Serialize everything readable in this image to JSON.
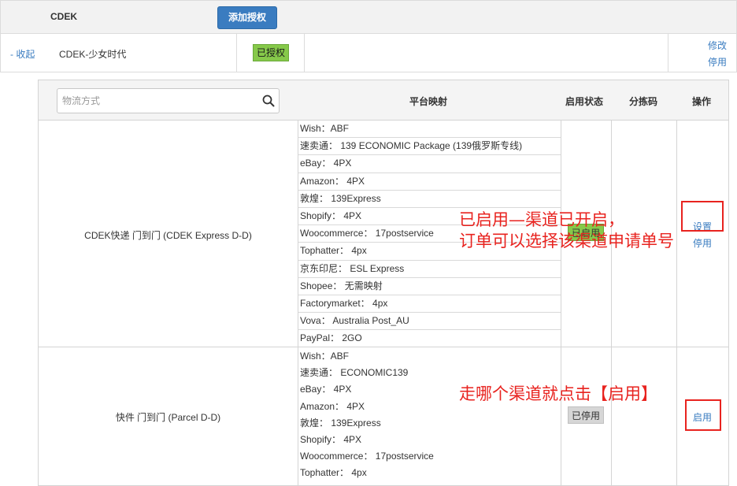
{
  "header": {
    "carrier_name": "CDEK",
    "add_auth_label": "添加授权"
  },
  "account": {
    "collapse_label": "- 收起",
    "name": "CDEK-少女时代",
    "auth_status": "已授权",
    "edit_label": "修改",
    "disable_label": "停用"
  },
  "table": {
    "search_placeholder": "物流方式",
    "columns": {
      "mapping": "平台映射",
      "status": "启用状态",
      "sort_code": "分拣码",
      "actions": "操作"
    },
    "rows": [
      {
        "channel": "CDEK快递 门到门 (CDEK Express D-D)",
        "mappings": [
          "Wish：ABF",
          "速卖通：  139 ECONOMIC Package (139俄罗斯专线)",
          "eBay：  4PX",
          "Amazon：  4PX",
          "敦煌：  139Express",
          "Shopify：  4PX",
          "Woocommerce：  17postservice",
          "Tophatter：  4px",
          "京东印尼：  ESL Express",
          "Shopee：  无需映射",
          "Factorymarket：  4px",
          "Vova：  Australia Post_AU",
          "PayPal：  2GO"
        ],
        "status": "已启用",
        "sort_code": "",
        "action_primary": "设置",
        "action_secondary": "停用"
      },
      {
        "channel": "快件 门到门 (Parcel D-D)",
        "mappings": [
          "Wish：ABF",
          "速卖通：  ECONOMIC139",
          "eBay：  4PX",
          "Amazon：  4PX",
          "敦煌：  139Express",
          "Shopify：  4PX",
          "Woocommerce：  17postservice",
          "Tophatter：  4px"
        ],
        "status": "已停用",
        "sort_code": "",
        "action_primary": "启用"
      }
    ]
  },
  "annotations": {
    "enabled_line1": "已启用—渠道已开启，",
    "enabled_line2": "订单可以选择该渠道申请单号",
    "enable_hint": "走哪个渠道就点击【启用】"
  },
  "colors": {
    "accent": "#3a7cc0",
    "enabled_badge": "#86c94a",
    "disabled_badge": "#d6d6d6",
    "annotation_red": "#e8231f"
  }
}
